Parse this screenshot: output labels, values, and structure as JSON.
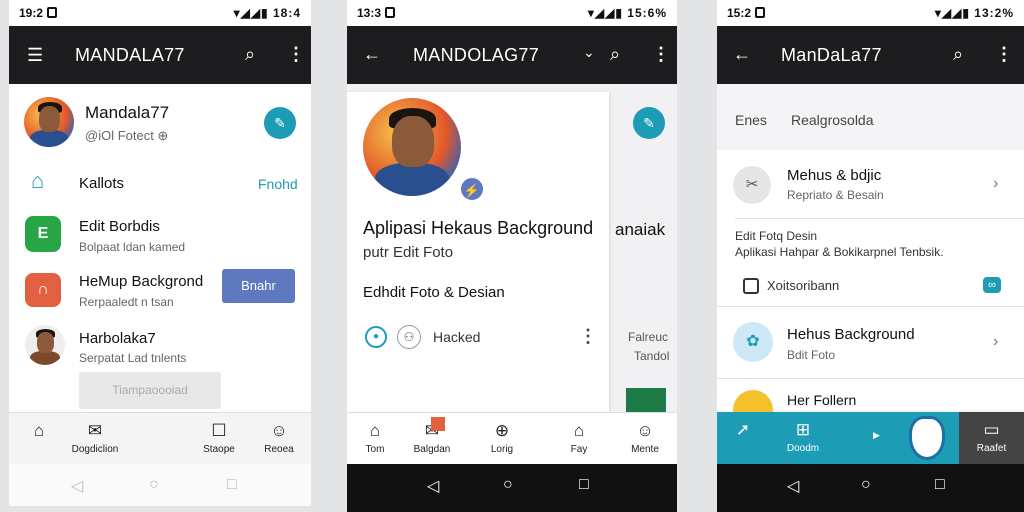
{
  "phone1": {
    "status": {
      "time": "19:2",
      "right": "▾◢◢▮ 18:4"
    },
    "appbar": {
      "title": "MANDALA77"
    },
    "profile": {
      "name": "Mandala77",
      "handle": "@iOl Fotect ⊕"
    },
    "rows": [
      {
        "title": "Kallots",
        "action": "Fnohd"
      },
      {
        "title": "Edit Borbdis",
        "sub": "Bolpaat ldan kamed"
      },
      {
        "title": "HeMup Backgrond",
        "sub": "Rerpaaledt n tsan",
        "button": "Bnahr"
      },
      {
        "title": "Harbolaka7",
        "sub": "Serpatat Lad tnlents"
      }
    ],
    "ghost_button": "Tiampaoooiad",
    "nav": [
      "Dogdiclion",
      "Staope",
      "Reoea"
    ]
  },
  "phone2": {
    "status": {
      "time": "13:3",
      "right": "▾◢◢▮ 15:6%"
    },
    "appbar": {
      "title": "MANDOLAG77"
    },
    "card": {
      "headline": "Aplipasi Hekaus Background",
      "sub": "putr Edit Foto",
      "section": "Edhdit Foto & Desian",
      "label": "Hacked"
    },
    "peek": {
      "title": "anaiak",
      "line1": "Falreuc",
      "line2": "Tandol"
    },
    "nav": [
      "Tom",
      "Balgdan",
      "Lorig",
      "Fay",
      "Mente"
    ]
  },
  "phone3": {
    "status": {
      "time": "15:2",
      "right": "▾◢◢▮ 13:2%"
    },
    "appbar": {
      "title": "ManDaLa77"
    },
    "tabs": {
      "left": "Enes",
      "right": "Realgrosolda"
    },
    "rows": [
      {
        "title": "Mehus & bdjic",
        "sub": "Repriato & Besain"
      },
      {
        "title": "Hehus Background",
        "sub": "Bdit Foto"
      },
      {
        "title": "Her Follern"
      }
    ],
    "block": {
      "line1": "Edit Fotq Desin",
      "line2": "Aplikasi Hahpar & Bokikarpnel Tenbsik.",
      "check": "Xoitsoribann"
    },
    "nav": [
      "Doodm",
      "Raafet"
    ]
  },
  "colors": {
    "teal": "#1d9cb5",
    "green": "#27a547",
    "orange": "#e2603f",
    "blue": "#5f79c1"
  }
}
